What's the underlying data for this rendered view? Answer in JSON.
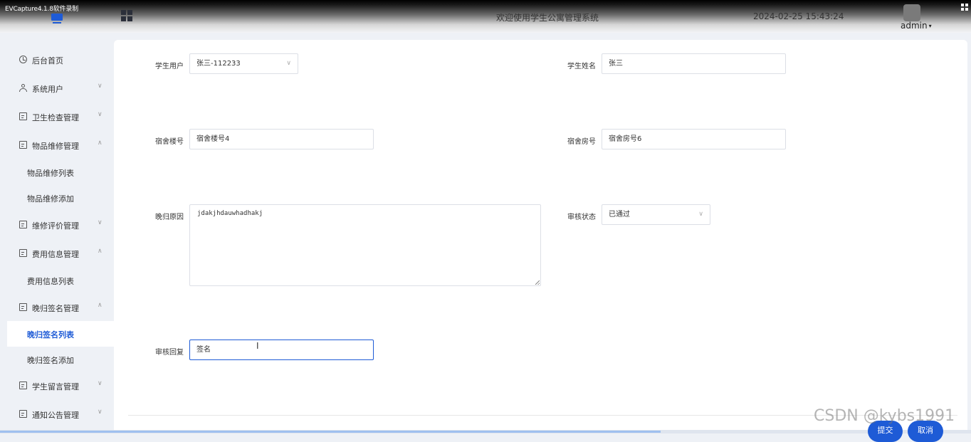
{
  "recorder_label": "EVCapture4.1.8软件录制",
  "header": {
    "title": "欢迎使用学生公寓管理系统",
    "datetime": "2024-02-25 15:43:24",
    "user": "admin"
  },
  "sidebar": {
    "items": [
      {
        "label": "后台首页",
        "icon": "clock-icon"
      },
      {
        "label": "系统用户",
        "icon": "user-icon",
        "arrow": "∨"
      },
      {
        "label": "卫生检查管理",
        "icon": "card-icon",
        "arrow": "∨"
      },
      {
        "label": "物品维修管理",
        "icon": "card-icon",
        "arrow": "∧"
      },
      {
        "label": "物品维修列表"
      },
      {
        "label": "物品维修添加"
      },
      {
        "label": "维修评价管理",
        "icon": "card-icon",
        "arrow": "∨"
      },
      {
        "label": "费用信息管理",
        "icon": "card-icon",
        "arrow": "∧"
      },
      {
        "label": "费用信息列表"
      },
      {
        "label": "晚归签名管理",
        "icon": "card-icon",
        "arrow": "∧"
      },
      {
        "label": "晚归签名列表",
        "active": true
      },
      {
        "label": "晚归签名添加"
      },
      {
        "label": "学生留言管理",
        "icon": "card-icon",
        "arrow": "∨"
      },
      {
        "label": "通知公告管理",
        "icon": "card-icon",
        "arrow": "∨"
      }
    ]
  },
  "form": {
    "student_user": {
      "label": "学生用户",
      "value": "张三-112233"
    },
    "student_name": {
      "label": "学生姓名",
      "value": "张三"
    },
    "building": {
      "label": "宿舍楼号",
      "value": "宿舍楼号4"
    },
    "room": {
      "label": "宿舍房号",
      "value": "宿舍房号6"
    },
    "reason": {
      "label": "晚归原因",
      "value": "jdakjhdauwhadhakj"
    },
    "audit_status": {
      "label": "审核状态",
      "value": "已通过"
    },
    "audit_reply": {
      "label": "审核回复",
      "value": "签名"
    }
  },
  "buttons": {
    "submit": "提交",
    "cancel": "取消"
  },
  "watermark": "CSDN @kybs1991",
  "colors": {
    "accent": "#1e5bd6",
    "background": "#eef1f6"
  },
  "progress": {
    "fraction": 0.68
  }
}
